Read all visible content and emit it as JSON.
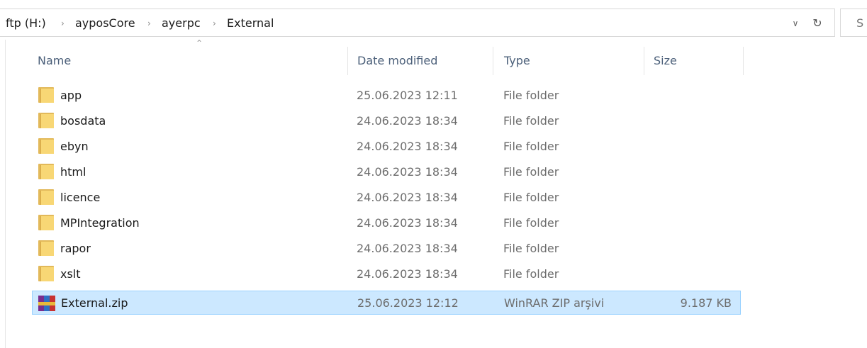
{
  "breadcrumb": {
    "items": [
      "ftp (H:)",
      "ayposCore",
      "ayerpc",
      "External"
    ],
    "separator": "›"
  },
  "search": {
    "placeholder": "S"
  },
  "toolbar": {
    "dropdown_icon": "chevron-down-icon",
    "refresh_icon": "refresh-icon"
  },
  "columns": {
    "name": "Name",
    "date": "Date modified",
    "type": "Type",
    "size": "Size"
  },
  "files": [
    {
      "name": "app",
      "date": "25.06.2023 12:11",
      "type": "File folder",
      "size": "",
      "icon": "folder-icon",
      "selected": false
    },
    {
      "name": "bosdata",
      "date": "24.06.2023 18:34",
      "type": "File folder",
      "size": "",
      "icon": "folder-icon",
      "selected": false
    },
    {
      "name": "ebyn",
      "date": "24.06.2023 18:34",
      "type": "File folder",
      "size": "",
      "icon": "folder-icon",
      "selected": false
    },
    {
      "name": "html",
      "date": "24.06.2023 18:34",
      "type": "File folder",
      "size": "",
      "icon": "folder-icon",
      "selected": false
    },
    {
      "name": "licence",
      "date": "24.06.2023 18:34",
      "type": "File folder",
      "size": "",
      "icon": "folder-icon",
      "selected": false
    },
    {
      "name": "MPIntegration",
      "date": "24.06.2023 18:34",
      "type": "File folder",
      "size": "",
      "icon": "folder-icon",
      "selected": false
    },
    {
      "name": "rapor",
      "date": "24.06.2023 18:34",
      "type": "File folder",
      "size": "",
      "icon": "folder-icon",
      "selected": false
    },
    {
      "name": "xslt",
      "date": "24.06.2023 18:34",
      "type": "File folder",
      "size": "",
      "icon": "folder-icon",
      "selected": false
    },
    {
      "name": "External.zip",
      "date": "25.06.2023 12:12",
      "type": "WinRAR ZIP arşivi",
      "size": "9.187 KB",
      "icon": "winrar-archive-icon",
      "selected": true
    }
  ],
  "colors": {
    "selection_background": "#cce8ff",
    "selection_border": "#99d1ff",
    "header_text": "#4c607a",
    "folder_yellow": "#f8d775"
  }
}
